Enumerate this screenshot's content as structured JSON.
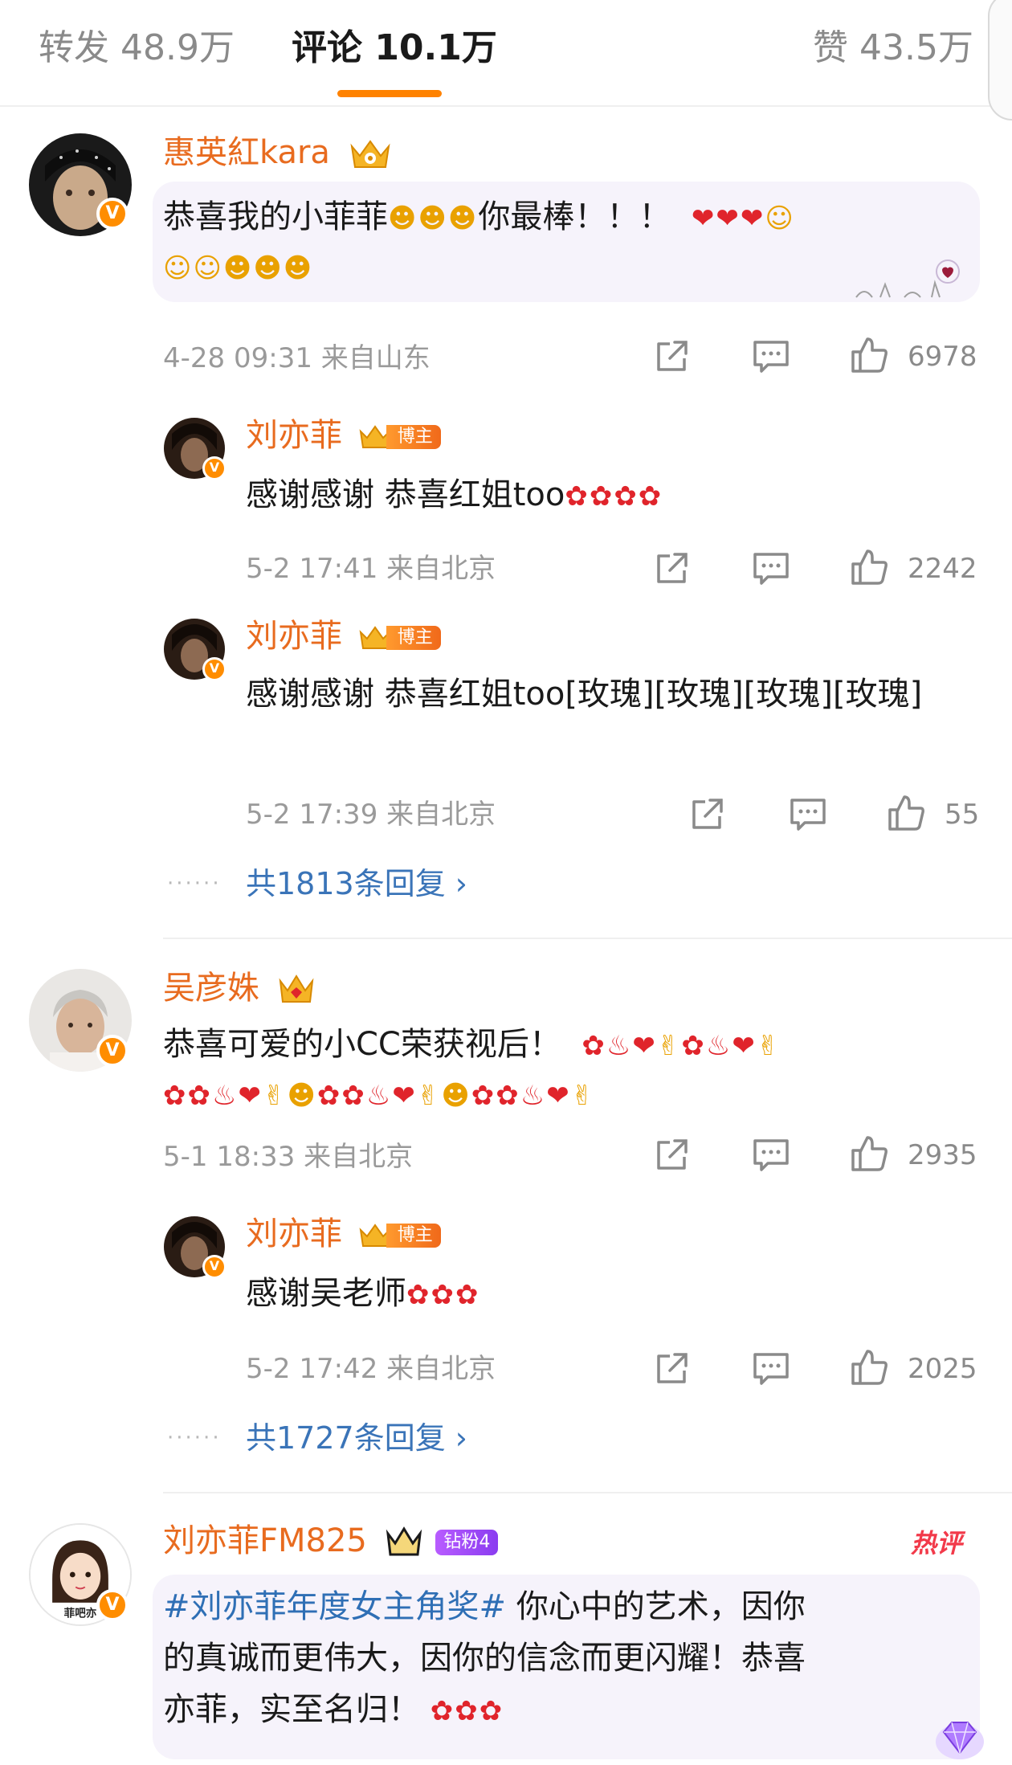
{
  "tabs": {
    "repost": "转发 48.9万",
    "comments": "评论 10.1万",
    "likes": "赞 43.5万"
  },
  "comments": [
    {
      "user": "惠英紅kara",
      "text": "恭喜我的小菲菲",
      "text_tail": "你最棒！！！",
      "time_loc": "4-28 09:31 来自山东",
      "likes": "6978",
      "replies": [
        {
          "user": "刘亦菲",
          "badge": "博主",
          "text": "感谢感谢 恭喜红姐too",
          "time_loc": "5-2 17:41 来自北京",
          "likes": "2242"
        },
        {
          "user": "刘亦菲",
          "badge": "博主",
          "text": "感谢感谢 恭喜红姐too[玫瑰][玫瑰][玫瑰][玫瑰]",
          "time_loc": "5-2 17:39 来自北京",
          "likes": "55"
        }
      ],
      "more_replies": "共1813条回复 ›"
    },
    {
      "user": "吴彦姝",
      "text": "恭喜可爱的小CC荣获视后！",
      "time_loc": "5-1 18:33 来自北京",
      "likes": "2935",
      "replies": [
        {
          "user": "刘亦菲",
          "badge": "博主",
          "text": "感谢吴老师",
          "time_loc": "5-2 17:42 来自北京",
          "likes": "2025"
        }
      ],
      "more_replies": "共1727条回复 ›"
    },
    {
      "user": "刘亦菲FM825",
      "fan_badge": "钻粉4",
      "hot_label": "热评",
      "topic": "#刘亦菲年度女主角奖#",
      "text_line1": " 你心中的艺术，因你",
      "text_line2": "的真诚而更伟大，因你的信念而更闪耀！恭喜",
      "text_line3": "亦菲，实至名归！",
      "avatar_text": "菲吧亦"
    }
  ],
  "icons": {
    "repost": "share-icon",
    "comment": "comment-icon",
    "like": "thumbs-up-icon",
    "verified": "verified-v-icon",
    "crown": "crown-icon"
  },
  "colors": {
    "accent": "#ff8200",
    "username": "#e86b1f",
    "link": "#3a74b8",
    "meta": "#9a9a9a",
    "hot": "#f23a4a"
  },
  "verified_mark": "V"
}
